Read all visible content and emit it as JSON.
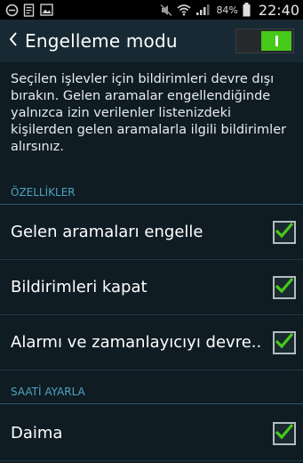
{
  "status_bar": {
    "battery_percent": "84%",
    "time": "22:40",
    "icons": [
      "minus-circle-icon",
      "document-icon",
      "image-icon",
      "mute-icon",
      "wifi-icon",
      "signal-icon",
      "battery-icon"
    ]
  },
  "action_bar": {
    "title": "Engelleme modu",
    "master_switch_on": true
  },
  "description": "Seçilen işlevler için bildirimleri devre dışı bırakın. Gelen aramalar engellendiğinde yalnızca izin verilenler listenizdeki kişilerden gelen aramalarla ilgili bildirimler alırsınız.",
  "sections": [
    {
      "header": "ÖZELLİKLER",
      "items": [
        {
          "label": "Gelen aramaları engelle",
          "checked": true
        },
        {
          "label": "Bildirimleri kapat",
          "checked": true
        },
        {
          "label": "Alarmı ve zamanlayıcıyı devre..",
          "checked": true
        }
      ]
    },
    {
      "header": "SAATİ AYARLA",
      "items": [
        {
          "label": "Daima",
          "checked": true
        }
      ]
    }
  ],
  "colors": {
    "background": "#0f1c23",
    "accent_green": "#46c91a",
    "section_header": "#4fa3c0"
  }
}
